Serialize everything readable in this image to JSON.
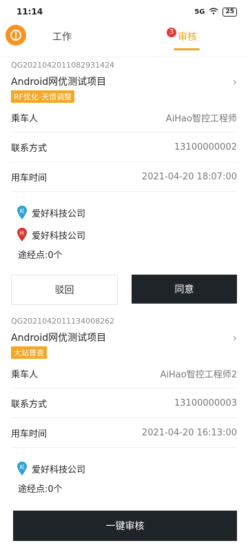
{
  "status_bar": {
    "time": "11:14",
    "signal": "5G",
    "battery": "25"
  },
  "header": {
    "tab_work": "工作",
    "tab_review": "审核",
    "review_badge": "3"
  },
  "cards": [
    {
      "order_id": "QG2021042011082931424",
      "project": "Android网优测试项目",
      "tag": "RF优化-天馈调整",
      "rows": [
        {
          "label": "乘车人",
          "value": "AiHao智控工程师"
        },
        {
          "label": "联系方式",
          "value": "13100000002"
        },
        {
          "label": "用车时间",
          "value": "2021-04-20 18:07:00"
        }
      ],
      "start_icon": "起",
      "start": "爱好科技公司",
      "end_icon": "终",
      "end": "爱好科技公司",
      "via": "途经点:0个",
      "reject": "驳回",
      "approve": "同意"
    },
    {
      "order_id": "QG2021042011134008262",
      "project": "Android网优测试项目",
      "tag": "大站普查",
      "rows": [
        {
          "label": "乘车人",
          "value": "AiHao智控工程师2"
        },
        {
          "label": "联系方式",
          "value": "13100000003"
        },
        {
          "label": "用车时间",
          "value": "2021-04-20 16:13:00"
        }
      ],
      "start_icon": "起",
      "start": "爱好科技公司",
      "via": "途经点:0个"
    }
  ],
  "bottom_button": "一键审核",
  "colors": {
    "accent": "#f0a419",
    "tag": "#f5a623",
    "dark_button": "#1f2429",
    "badge": "#e53935"
  }
}
